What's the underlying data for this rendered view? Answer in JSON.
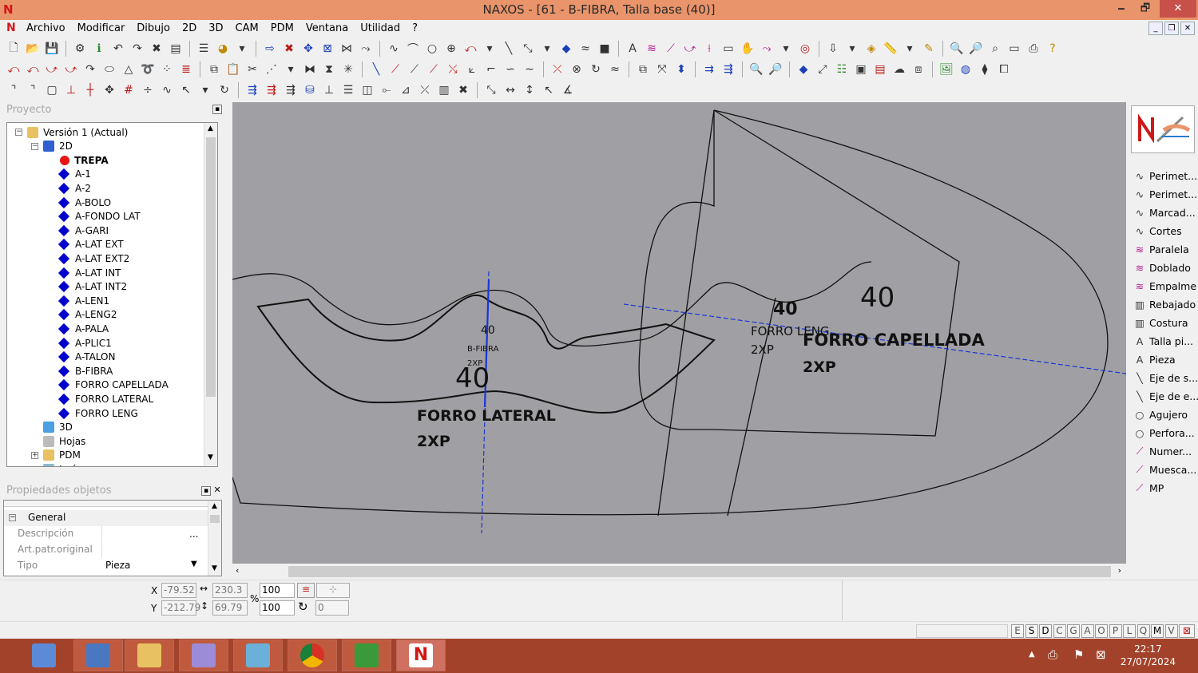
{
  "window": {
    "title": "NAXOS - [61 - B-FIBRA, Talla base (40)]",
    "app_icon": "N",
    "minimize": "🗕",
    "restore": "🗗",
    "close": "✕"
  },
  "menu": [
    "Archivo",
    "Modificar",
    "Dibujo",
    "2D",
    "3D",
    "CAM",
    "PDM",
    "Ventana",
    "Utilidad",
    "?"
  ],
  "project_panel": {
    "title": "Proyecto"
  },
  "tree": [
    {
      "label": "Versión 1 (Actual)",
      "level": 0,
      "icon": "version"
    },
    {
      "label": "2D",
      "level": 1,
      "icon": "folder-2d"
    },
    {
      "label": "TREPA",
      "level": 2,
      "icon": "red-dot",
      "bold": true
    },
    {
      "label": "A-1",
      "level": 2
    },
    {
      "label": "A-2",
      "level": 2
    },
    {
      "label": "A-BOLO",
      "level": 2
    },
    {
      "label": "A-FONDO LAT",
      "level": 2
    },
    {
      "label": "A-GARI",
      "level": 2
    },
    {
      "label": "A-LAT EXT",
      "level": 2
    },
    {
      "label": "A-LAT EXT2",
      "level": 2
    },
    {
      "label": "A-LAT INT",
      "level": 2
    },
    {
      "label": "A-LAT INT2",
      "level": 2
    },
    {
      "label": "A-LEN1",
      "level": 2
    },
    {
      "label": "A-LENG2",
      "level": 2
    },
    {
      "label": "A-PALA",
      "level": 2
    },
    {
      "label": "A-PLIC1",
      "level": 2
    },
    {
      "label": "A-TALON",
      "level": 2
    },
    {
      "label": "B-FIBRA",
      "level": 2
    },
    {
      "label": "FORRO CAPELLADA",
      "level": 2
    },
    {
      "label": "FORRO LATERAL",
      "level": 2
    },
    {
      "label": "FORRO LENG",
      "level": 2
    },
    {
      "label": "3D",
      "level": 1,
      "icon": "3d"
    },
    {
      "label": "Hojas",
      "level": 1,
      "icon": "sheets"
    },
    {
      "label": "PDM",
      "level": 1,
      "icon": "pdm"
    },
    {
      "label": "Imágenes",
      "level": 1,
      "icon": "images"
    }
  ],
  "props_panel": {
    "title": "Propiedades objetos",
    "section": "General",
    "rows": [
      {
        "label": "Descripción",
        "value": "",
        "btn": "..."
      },
      {
        "label": "Art.patr.original",
        "value": ""
      },
      {
        "label": "Tipo",
        "value": "Pieza"
      }
    ]
  },
  "canvas": {
    "labels": [
      {
        "text": "40",
        "cls": "small"
      },
      {
        "text": "B-FIBRA",
        "cls": "tiny"
      },
      {
        "text": "2XP",
        "cls": "tiny"
      },
      {
        "text": "40",
        "cls": "big"
      },
      {
        "text": "FORRO LATERAL",
        "cls": "bold"
      },
      {
        "text": "2XP",
        "cls": "bold"
      },
      {
        "text": "40",
        "cls": "mid"
      },
      {
        "text": "FORRO LENG",
        "cls": "med"
      },
      {
        "text": "2XP",
        "cls": "med"
      },
      {
        "text": "40",
        "cls": "big"
      },
      {
        "text": "FORRO CAPELLADA",
        "cls": "bold"
      },
      {
        "text": "2XP",
        "cls": "bold"
      }
    ]
  },
  "right_panel": [
    {
      "label": "Perimet...",
      "icon": "curve-icon"
    },
    {
      "label": "Perimet...",
      "icon": "curve-icon"
    },
    {
      "label": "Marcad...",
      "icon": "curve-icon"
    },
    {
      "label": "Cortes",
      "icon": "curve-icon"
    },
    {
      "label": "Paralela",
      "icon": "parallel-icon"
    },
    {
      "label": "Doblado",
      "icon": "fold-icon"
    },
    {
      "label": "Empalme",
      "icon": "join-icon"
    },
    {
      "label": "Rebajado",
      "icon": "skive-icon"
    },
    {
      "label": "Costura",
      "icon": "seam-icon"
    },
    {
      "label": "Talla pi...",
      "icon": "text-icon"
    },
    {
      "label": "Pieza",
      "icon": "text-icon"
    },
    {
      "label": "Eje de s...",
      "icon": "axis-icon"
    },
    {
      "label": "Eje de e...",
      "icon": "axis-icon"
    },
    {
      "label": "Agujero",
      "icon": "circle-icon"
    },
    {
      "label": "Perfora...",
      "icon": "circle-icon"
    },
    {
      "label": "Numer...",
      "icon": "pen-icon"
    },
    {
      "label": "Muesca...",
      "icon": "pen-icon"
    },
    {
      "label": "MP",
      "icon": "pen-icon"
    }
  ],
  "coords": {
    "x_label": "X",
    "y_label": "Y",
    "x": "-79.52",
    "y": "-212.79",
    "w": "230.3",
    "h": "69.79",
    "sx": "100",
    "sy": "100",
    "pct": "%",
    "angle": "0"
  },
  "status_letters": [
    "E",
    "S",
    "D",
    "C",
    "G",
    "A",
    "O",
    "P",
    "L",
    "Q",
    "M",
    "V"
  ],
  "clock": {
    "time": "22:17",
    "date": "27/07/2024"
  },
  "colors": {
    "accent": "#e9946a",
    "taskbar": "#a3422a",
    "canvas": "#a0a0a4",
    "selection_axis": "#1a35d8"
  }
}
